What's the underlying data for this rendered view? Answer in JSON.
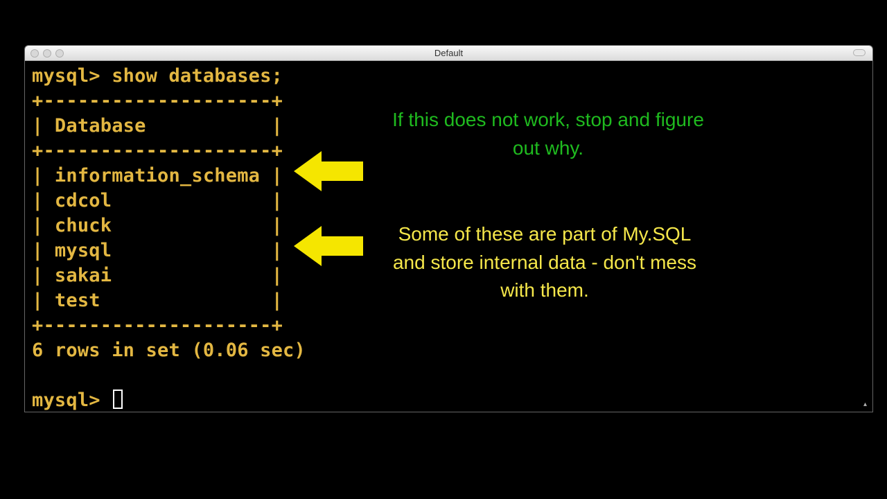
{
  "window": {
    "title": "Default"
  },
  "terminal": {
    "prompt": "mysql>",
    "command": "show databases;",
    "border_top": "+--------------------+",
    "header_row": "| Database           |",
    "border_mid": "+--------------------+",
    "rows": [
      "| information_schema |",
      "| cdcol              |",
      "| chuck              |",
      "| mysql              |",
      "| sakai              |",
      "| test               |"
    ],
    "border_bot": "+--------------------+",
    "result": "6 rows in set (0.06 sec)",
    "prompt2": "mysql> "
  },
  "annotations": {
    "top": "If this does not work, stop and figure out why.",
    "bottom": "Some of these are part of My.SQL and store internal data - don't mess with them."
  },
  "arrows": {
    "color": "#f5e600"
  }
}
